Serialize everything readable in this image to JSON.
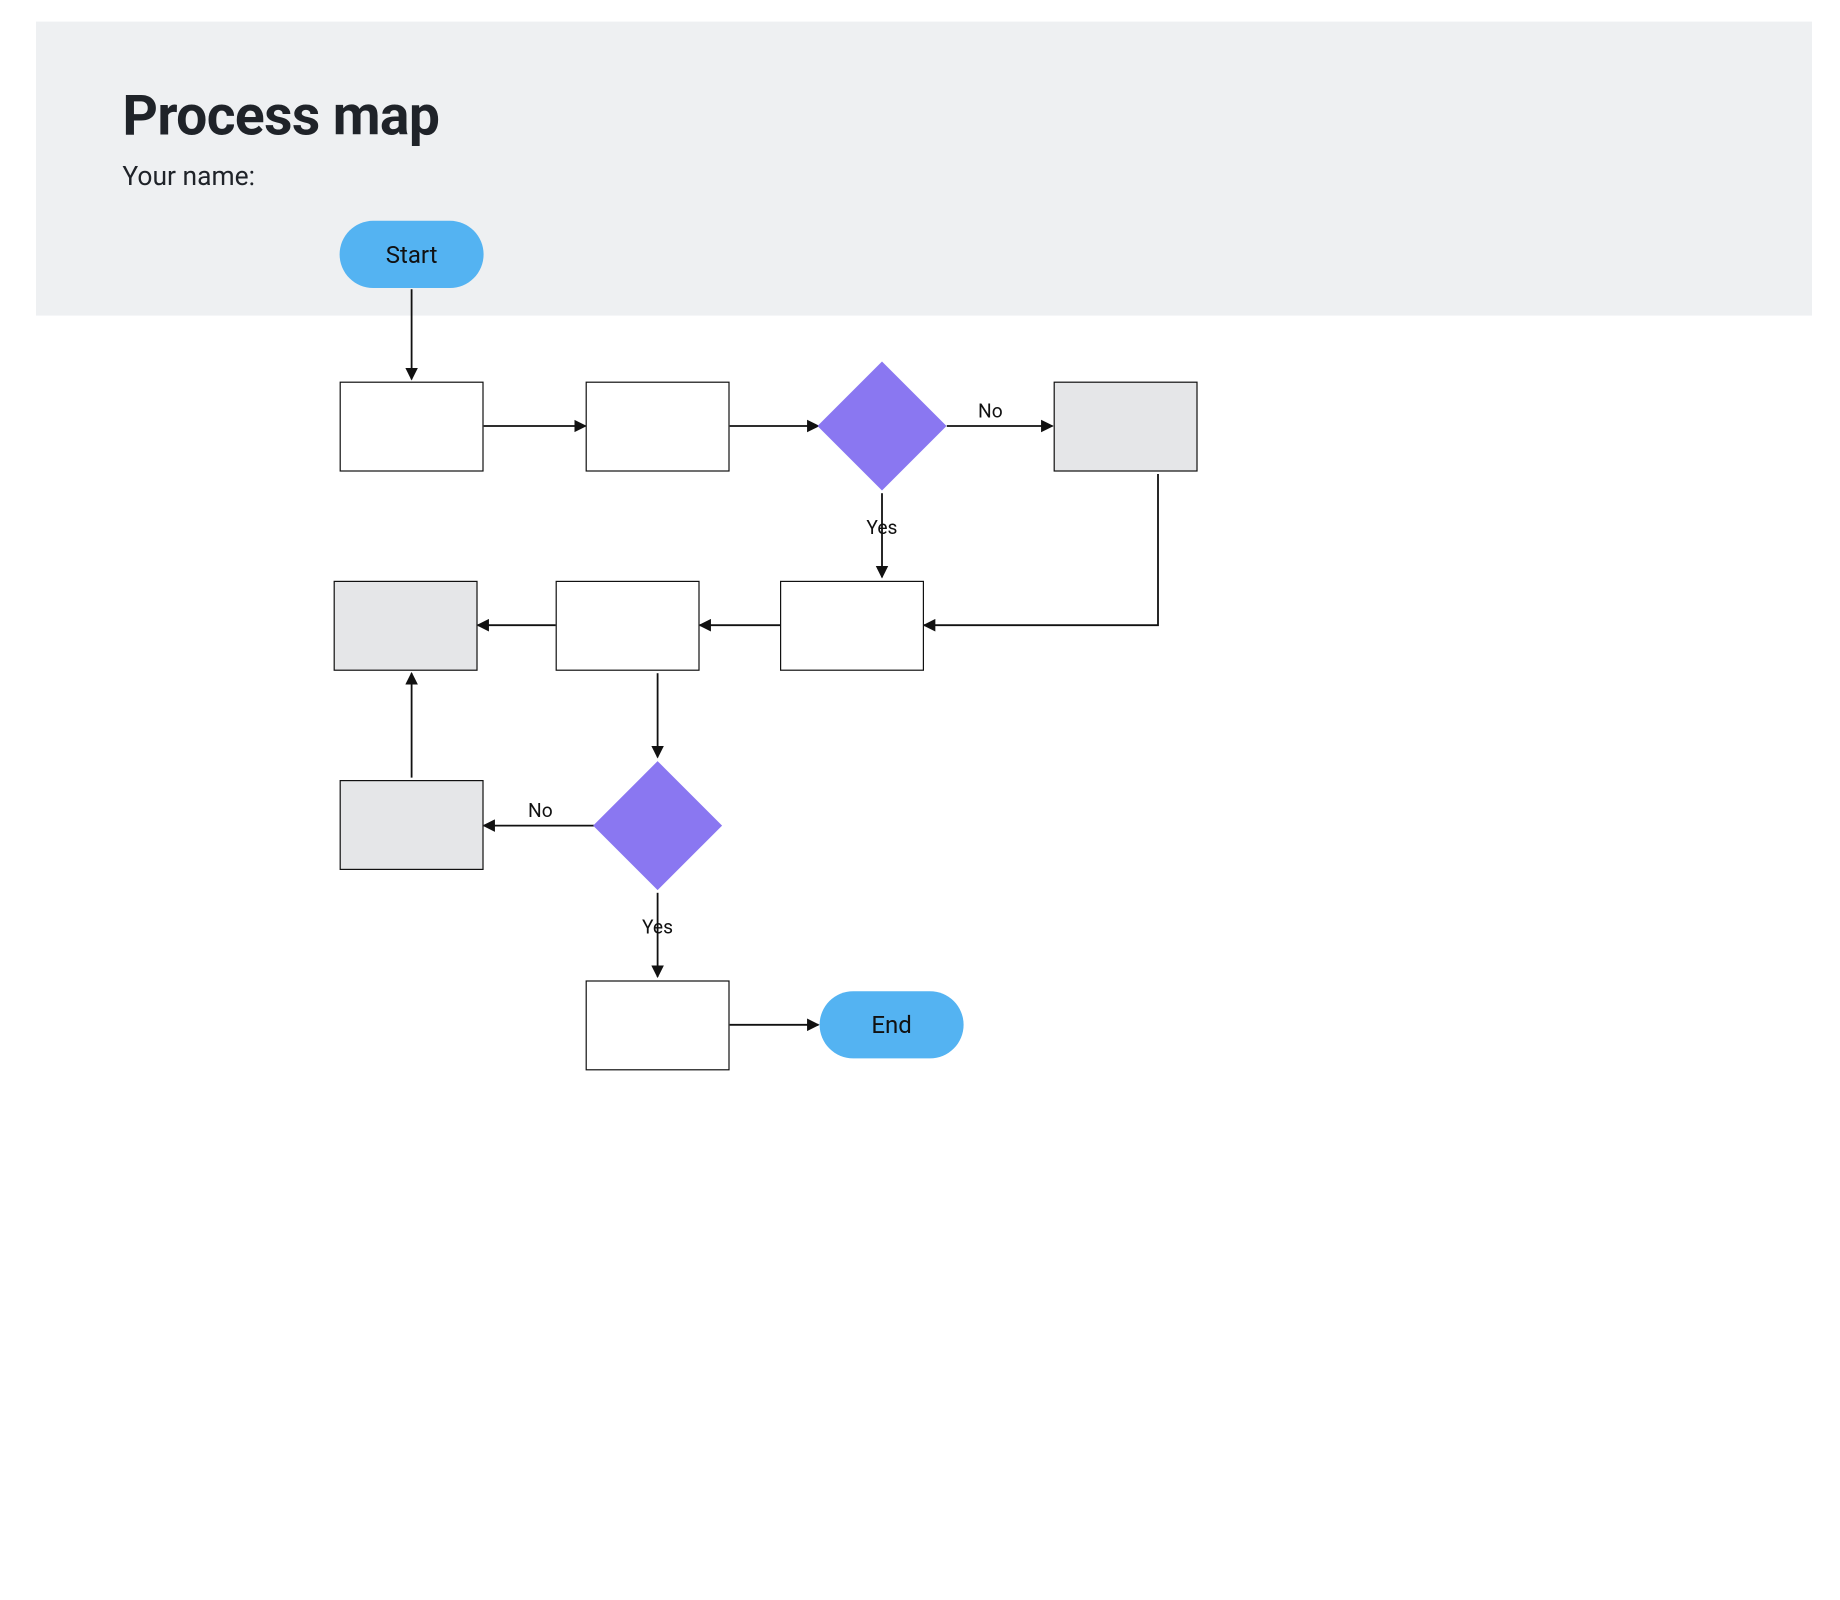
{
  "header": {
    "title": "Process map",
    "subtitle": "Your name:"
  },
  "nodes": {
    "start": {
      "label": "Start"
    },
    "end": {
      "label": "End"
    }
  },
  "edge_labels": {
    "d1_no": "No",
    "d1_yes": "Yes",
    "d2_no": "No",
    "d2_yes": "Yes"
  }
}
